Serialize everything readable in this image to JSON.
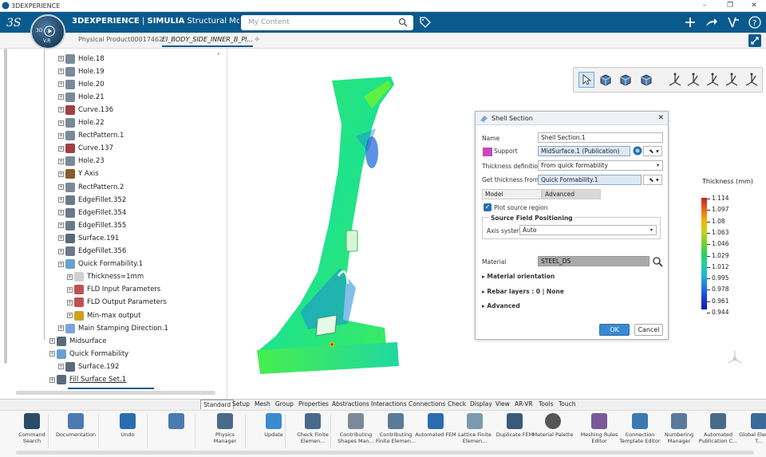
{
  "window": {
    "title": "3DEXPERIENCE"
  },
  "header": {
    "brand": "3DEXPERIENCE",
    "app_separator": " | ",
    "app_brand": "SIMULIA",
    "app_title": "Structural Model Crea...",
    "compass_version": "V.R",
    "compass_badge": "3D",
    "search_placeholder": "My Content"
  },
  "tabs": [
    {
      "label": "Physical Product00017462",
      "active": false
    },
    {
      "label": "EI_BODY_SIDE_INNER_B_PI...",
      "active": true
    }
  ],
  "tree": {
    "nodes": [
      {
        "label": "Hole.18",
        "icon": "hole-icon"
      },
      {
        "label": "Hole.19",
        "icon": "hole-icon"
      },
      {
        "label": "Hole.20",
        "icon": "hole-icon"
      },
      {
        "label": "Hole.21",
        "icon": "hole-icon"
      },
      {
        "label": "Curve.136",
        "icon": "curve-icon"
      },
      {
        "label": "Hole.22",
        "icon": "hole-icon"
      },
      {
        "label": "RectPattern.1",
        "icon": "pattern-icon"
      },
      {
        "label": "Curve.137",
        "icon": "curve-icon"
      },
      {
        "label": "Hole.23",
        "icon": "hole-icon"
      },
      {
        "label": "Y Axis",
        "icon": "axis-icon"
      },
      {
        "label": "RectPattern.2",
        "icon": "pattern-icon"
      },
      {
        "label": "EdgeFillet.352",
        "icon": "fillet-icon"
      },
      {
        "label": "EdgeFillet.354",
        "icon": "fillet-icon"
      },
      {
        "label": "EdgeFillet.355",
        "icon": "fillet-icon"
      },
      {
        "label": "Surface.191",
        "icon": "surface-icon"
      },
      {
        "label": "EdgeFillet.356",
        "icon": "fillet-icon"
      },
      {
        "label": "Quick Formability.1",
        "icon": "formability-icon"
      },
      {
        "label": "Thickness=1mm",
        "icon": "parameter-icon"
      },
      {
        "label": "FLD Input Parameters",
        "icon": "fld-icon"
      },
      {
        "label": "FLD Output Parameters",
        "icon": "fld-icon"
      },
      {
        "label": "Min-max output",
        "icon": "minmax-icon"
      },
      {
        "label": "Main Stamping Direction.1",
        "icon": "direction-icon"
      },
      {
        "label": "Midsurface",
        "icon": "surface-icon"
      },
      {
        "label": "Quick Formability",
        "icon": "formability-icon"
      },
      {
        "label": "Surface.192",
        "icon": "surface-icon"
      },
      {
        "label": "Fill Surface Set.1",
        "icon": "fill-icon"
      }
    ]
  },
  "dialog": {
    "title": "Shell Section",
    "name_label": "Name",
    "name_value": "Shell Section.1",
    "support_label": "Support",
    "support_value": "MidSurface.1 (Publication)",
    "thickness_def_label": "Thickness definition",
    "thickness_def_value": "From quick formability",
    "thickness_from_label": "Get thickness from",
    "thickness_from_value": "Quick Formability.1",
    "tab_model": "Model",
    "tab_advanced": "Advanced",
    "plot_source": "Plot source region",
    "source_field": "Source Field Positioning",
    "axis_label": "Axis system",
    "axis_value": "Auto",
    "material_label": "Material",
    "material_value": "STEEL_DS",
    "material_orientation": "Material orientation",
    "rebar_layers": "Rebar layers : 0 | None",
    "advanced": "Advanced",
    "ok": "OK",
    "cancel": "Cancel"
  },
  "legend": {
    "title": "Thickness (mm)",
    "values": [
      "1.114",
      "1.097",
      "1.08",
      "1.063",
      "1.046",
      "1.029",
      "1.012",
      "0.995",
      "0.978",
      "0.961",
      "0.944"
    ],
    "colors": [
      "#c81e1e",
      "#e8641e",
      "#f0b400",
      "#c8d21e",
      "#78d228",
      "#28d25a",
      "#1ed2a0",
      "#1eb4dc",
      "#1e78e6",
      "#1e3cdc",
      "#1414b4"
    ]
  },
  "bottom_tabs": [
    "Standard",
    "Setup",
    "Mesh",
    "Group",
    "Properties",
    "Abstractions",
    "Interactions",
    "Connections",
    "Check",
    "Display",
    "View",
    "AR-VR",
    "Tools",
    "Touch"
  ],
  "ribbon": [
    {
      "label": "Command Search",
      "icon": "command-search-icon"
    },
    {
      "label": "Documentation",
      "icon": "documentation-icon"
    },
    {
      "label": "Undo",
      "icon": "undo-icon"
    },
    {
      "label": "",
      "icon": "model-icon"
    },
    {
      "label": "Physics Manager",
      "icon": "physics-manager-icon"
    },
    {
      "label": "Update",
      "icon": "update-icon"
    },
    {
      "label": "Check Finite Elemen...",
      "icon": "check-fe-icon"
    },
    {
      "label": "Contributing Shapes Man...",
      "icon": "shapes-icon"
    },
    {
      "label": "Contributing Finite Elemen...",
      "icon": "contrib-fe-icon"
    },
    {
      "label": "Automated FEM",
      "icon": "auto-fem-icon"
    },
    {
      "label": "Lattice Finite Elemen...",
      "icon": "lattice-icon"
    },
    {
      "label": "Duplicate FEM",
      "icon": "duplicate-fem-icon"
    },
    {
      "label": "Material Palette",
      "icon": "material-palette-icon"
    },
    {
      "label": "Meshing Rules Editor",
      "icon": "meshing-rules-icon"
    },
    {
      "label": "Connection Template Editor",
      "icon": "connection-template-icon"
    },
    {
      "label": "Numbering Manager",
      "icon": "numbering-icon"
    },
    {
      "label": "Automated Publication C...",
      "icon": "publication-icon"
    },
    {
      "label": "Global Element T...",
      "icon": "global-element-icon"
    }
  ]
}
